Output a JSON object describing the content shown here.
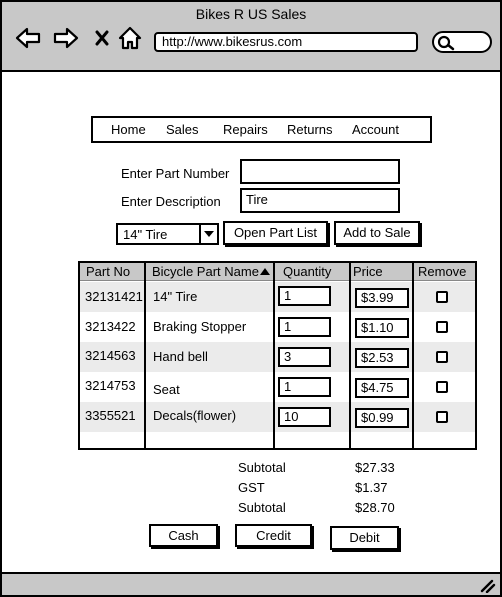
{
  "window": {
    "title": "Bikes R US Sales"
  },
  "browser": {
    "url": "http://www.bikesrus.com",
    "icons": [
      "back-arrow-icon",
      "forward-arrow-icon",
      "close-x-icon",
      "home-icon",
      "search-icon"
    ]
  },
  "menu": {
    "items": [
      "Home",
      "Sales",
      "Repairs",
      "Returns",
      "Account"
    ]
  },
  "form": {
    "part_number_label": "Enter Part Number",
    "part_number_value": "",
    "description_label": "Enter Description",
    "description_value": "Tire",
    "select_value": "14\" Tire",
    "open_part_list_label": "Open Part List",
    "add_to_sale_label": "Add to Sale"
  },
  "table": {
    "headers": [
      "Part No",
      "Bicycle Part Name",
      "Quantity",
      "Price",
      "Remove"
    ],
    "sort_column": "Bicycle Part Name",
    "rows": [
      {
        "part_no": "32131421",
        "name": "14\" Tire",
        "quantity": "1",
        "price": "$3.99",
        "remove": false
      },
      {
        "part_no": "3213422",
        "name": "Braking Stopper",
        "quantity": "1",
        "price": "$1.10",
        "remove": false
      },
      {
        "part_no": "3214563",
        "name": "Hand bell",
        "quantity": "3",
        "price": "$2.53",
        "remove": false
      },
      {
        "part_no": "3214753",
        "name": "Seat",
        "quantity": "1",
        "price": "$4.75",
        "remove": false
      },
      {
        "part_no": "3355521",
        "name": "Decals(flower)",
        "quantity": "10",
        "price": "$0.99",
        "remove": false
      }
    ]
  },
  "totals": {
    "subtotal_label": "Subtotal",
    "subtotal_value": "$27.33",
    "gst_label": "GST",
    "gst_value": "$1.37",
    "total_label": "Subtotal",
    "total_value": "$28.70"
  },
  "payment": {
    "cash_label": "Cash",
    "credit_label": "Credit",
    "debit_label": "Debit"
  },
  "colors": {
    "chrome": "#c8c8c8",
    "row_band": "#ebebeb",
    "ink": "#000000"
  }
}
